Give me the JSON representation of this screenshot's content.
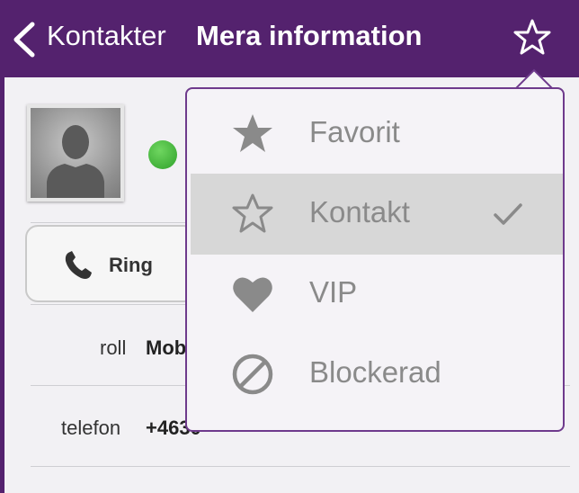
{
  "nav": {
    "back_label": "Kontakter",
    "title": "Mera information",
    "favorite_icon": "star-outline-icon"
  },
  "contact": {
    "status_color": "#3bb132"
  },
  "actions": {
    "ring_label": "Ring"
  },
  "details": {
    "rows": [
      {
        "label": "roll",
        "value": "Mob"
      },
      {
        "label": "telefon",
        "value": "+4630"
      }
    ]
  },
  "menu": {
    "items": [
      {
        "label": "Favorit",
        "icon": "star-filled-icon",
        "selected": false
      },
      {
        "label": "Kontakt",
        "icon": "star-outline-icon",
        "selected": true
      },
      {
        "label": "VIP",
        "icon": "heart-icon",
        "selected": false
      },
      {
        "label": "Blockerad",
        "icon": "block-icon",
        "selected": false
      }
    ],
    "check_icon": "checkmark-icon"
  },
  "colors": {
    "brand": "#54226e",
    "menu_border": "#6e3a8c",
    "menu_selected_bg": "#d7d7d7",
    "menu_text": "#8a8a8a"
  }
}
